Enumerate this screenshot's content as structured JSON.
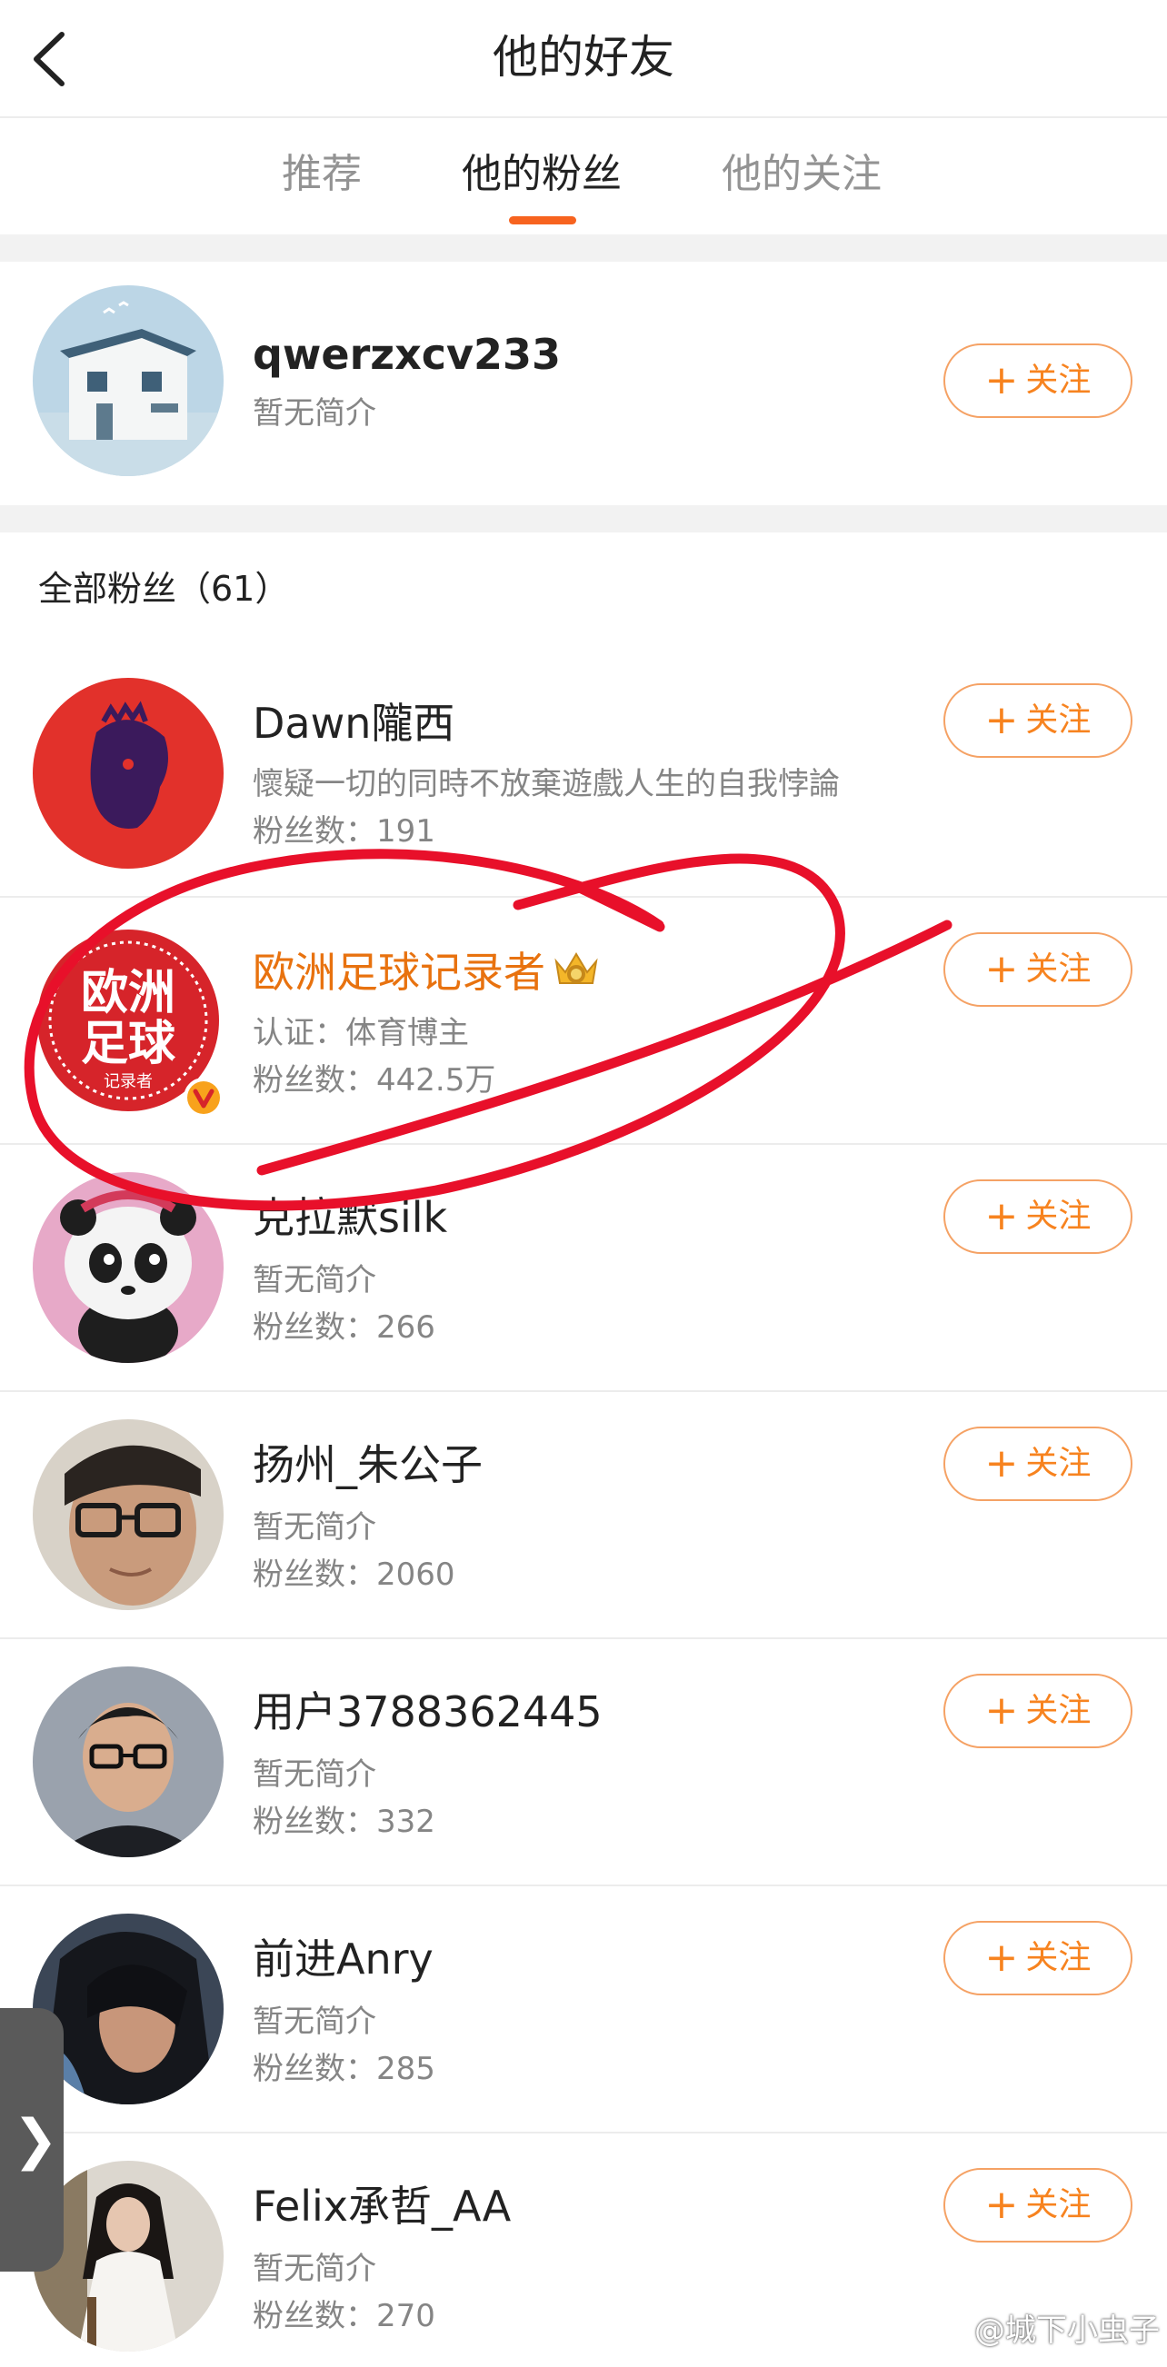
{
  "header": {
    "title": "他的好友"
  },
  "tabs": [
    {
      "label": "推荐"
    },
    {
      "label": "他的粉丝",
      "active": true
    },
    {
      "label": "他的关注"
    }
  ],
  "profile": {
    "name": "qwerzxcv233",
    "bio": "暂无简介",
    "follow_label": "关注"
  },
  "section_title": "全部粉丝（61）",
  "fans": [
    {
      "name": "Dawn隴西",
      "line1": "懷疑一切的同時不放棄遊戲人生的自我悖論",
      "line2": "粉丝数：191",
      "follow_label": "关注"
    },
    {
      "name": "欧洲足球记录者",
      "line1": "认证：体育博主",
      "line2": "粉丝数：442.5万",
      "follow_label": "关注",
      "verified": true,
      "avatar_text": [
        "欧洲",
        "足球",
        "记录者"
      ]
    },
    {
      "name": "克拉默silk",
      "line1": "暂无简介",
      "line2": "粉丝数：266",
      "follow_label": "关注"
    },
    {
      "name": "扬州_朱公子",
      "line1": "暂无简介",
      "line2": "粉丝数：2060",
      "follow_label": "关注"
    },
    {
      "name": "用户3788362445",
      "line1": "暂无简介",
      "line2": "粉丝数：332",
      "follow_label": "关注"
    },
    {
      "name": "前进Anry",
      "line1": "暂无简介",
      "line2": "粉丝数：285",
      "follow_label": "关注"
    },
    {
      "name": "Felix承哲_AA",
      "line1": "暂无简介",
      "line2": "粉丝数：270",
      "follow_label": "关注"
    }
  ],
  "side_tab_glyph": "❯",
  "watermark": "@城下小虫子",
  "colors": {
    "accent": "#f7831f",
    "tab_indicator": "#f7631f",
    "verified_name": "#e8720f",
    "annotation": "#e8102a"
  }
}
